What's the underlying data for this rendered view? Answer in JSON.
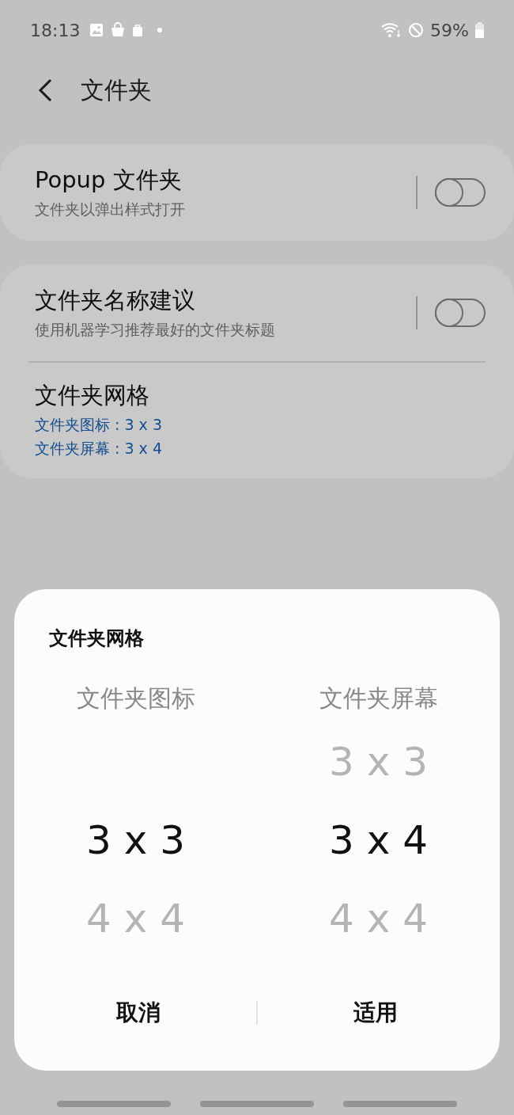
{
  "status_bar": {
    "time": "18:13",
    "battery": "59%"
  },
  "header": {
    "title": "文件夹"
  },
  "cards": [
    {
      "items": [
        {
          "kind": "toggle",
          "title": "Popup 文件夹",
          "subtitle": "文件夹以弹出样式打开",
          "on": false
        }
      ]
    },
    {
      "items": [
        {
          "kind": "toggle",
          "title": "文件夹名称建议",
          "subtitle": "使用机器学习推荐最好的文件夹标题",
          "on": false
        },
        {
          "kind": "detail",
          "title": "文件夹网格",
          "values": [
            "文件夹图标 : 3 x 3",
            "文件夹屏幕 : 3 x 4"
          ]
        }
      ]
    }
  ],
  "dialog": {
    "title": "文件夹网格",
    "pickers": [
      {
        "label": "文件夹图标",
        "options": [
          {
            "value": "3 x 3",
            "selected": true
          },
          {
            "value": "4 x 4",
            "selected": false
          }
        ]
      },
      {
        "label": "文件夹屏幕",
        "options": [
          {
            "value": "3 x 3",
            "selected": false
          },
          {
            "value": "3 x 4",
            "selected": true
          },
          {
            "value": "4 x 4",
            "selected": false
          }
        ]
      }
    ],
    "buttons": [
      "取消",
      "适用"
    ]
  }
}
